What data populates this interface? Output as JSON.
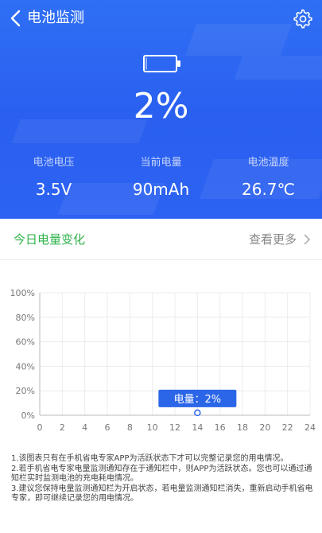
{
  "header": {
    "title": "电池监测",
    "battery_percent": "2%",
    "battery_level": 0.02
  },
  "stats": [
    {
      "label": "电池电压",
      "value": "3.5V"
    },
    {
      "label": "当前电量",
      "value": "90mAh"
    },
    {
      "label": "电池温度",
      "value": "26.7℃"
    }
  ],
  "section": {
    "title": "今日电量变化",
    "more": "查看更多"
  },
  "colors": {
    "header_blue": "#2f6ff4",
    "accent_green": "#2fb34b",
    "tooltip_blue": "#2b66e8"
  },
  "icons": {
    "back": "chevron-left-icon",
    "settings": "gear-icon",
    "battery": "battery-icon",
    "more": "chevron-right-icon"
  },
  "chart_data": {
    "type": "line",
    "x_ticks": [
      "0",
      "2",
      "4",
      "6",
      "8",
      "10",
      "12",
      "14",
      "16",
      "18",
      "20",
      "22",
      "24"
    ],
    "y_ticks": [
      "0%",
      "20%",
      "40%",
      "60%",
      "80%",
      "100%"
    ],
    "xlim": [
      0,
      24
    ],
    "ylim": [
      0,
      100
    ],
    "grid": true,
    "points": [
      {
        "x": 14,
        "y": 2
      }
    ],
    "tooltip": "电量：2%"
  },
  "notes": [
    "1.该图表只有在手机省电专家APP为活跃状态下才可以完整记录您的用电情况。",
    "2.若手机省电专家电量监测通知存在于通知栏中，则APP为活跃状态。您也可以通过通知栏实时监测电池的充电耗电情况。",
    "3.建议您保持电量监测通知栏为开启状态，若电量监测通知栏消失，重新启动手机省电专家，即可继续记录您的用电情况。"
  ]
}
